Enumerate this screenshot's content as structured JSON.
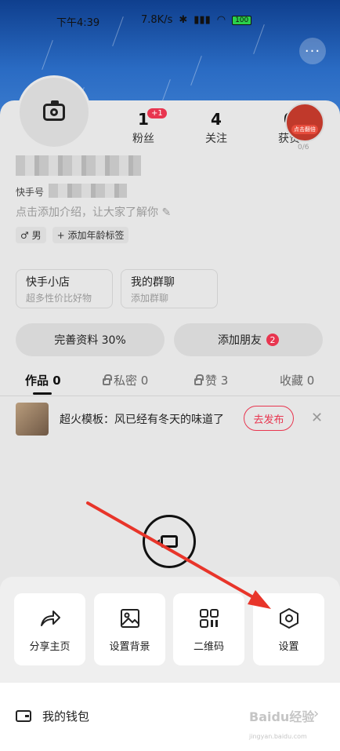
{
  "status_bar": {
    "time": "下午4:39",
    "speed": "7.8K/s",
    "battery": "100"
  },
  "profile": {
    "stats": [
      {
        "num": "1",
        "label": "粉丝",
        "badge": "+1"
      },
      {
        "num": "4",
        "label": "关注"
      },
      {
        "num": "0",
        "label": "获赞"
      }
    ],
    "red_packet": {
      "label": "点击翻倍",
      "count": "0/6"
    },
    "id_prefix": "快手号",
    "intro_placeholder": "点击添加介绍，让大家了解你",
    "tags": {
      "gender": "男",
      "age": "添加年龄标签"
    }
  },
  "shortcuts": [
    {
      "title": "快手小店",
      "sub": "超多性价比好物"
    },
    {
      "title": "我的群聊",
      "sub": "添加群聊"
    }
  ],
  "buttons": {
    "complete_profile": "完善资料 30%",
    "add_friend": "添加朋友",
    "add_friend_badge": "2"
  },
  "tabs": [
    {
      "label": "作品",
      "count": "0"
    },
    {
      "label": "私密",
      "count": "0"
    },
    {
      "label": "赞",
      "count": "3"
    },
    {
      "label": "收藏",
      "count": "0"
    }
  ],
  "template": {
    "text": "超火模板：风已经有冬天的味道了",
    "button": "去发布"
  },
  "sheet": {
    "actions": [
      {
        "label": "分享主页",
        "icon": "share-icon"
      },
      {
        "label": "设置背景",
        "icon": "image-icon"
      },
      {
        "label": "二维码",
        "icon": "qrcode-icon"
      },
      {
        "label": "设置",
        "icon": "settings-hexagon-icon"
      }
    ],
    "wallet_label": "我的钱包"
  },
  "watermark": {
    "main": "Baidu经验",
    "sub": "jingyan.baidu.com"
  },
  "colors": {
    "accent": "#e8354f",
    "hero": "#2a6bc3",
    "arrow": "#e8352a"
  }
}
